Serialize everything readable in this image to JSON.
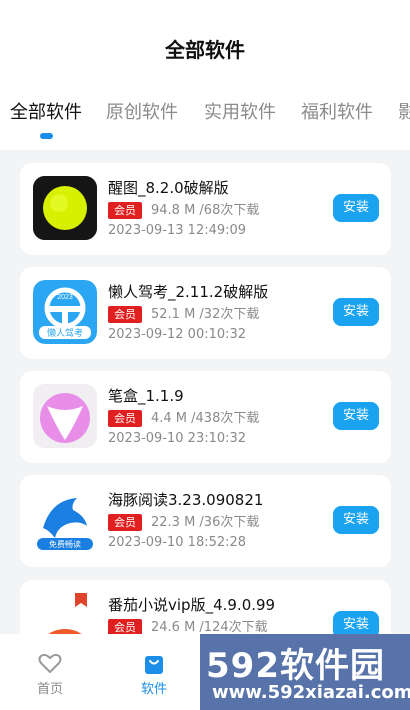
{
  "header": {
    "title": "全部软件"
  },
  "tabs": [
    {
      "label": "全部软件",
      "active": true
    },
    {
      "label": "原创软件"
    },
    {
      "label": "实用软件"
    },
    {
      "label": "福利软件"
    },
    {
      "label": "影"
    }
  ],
  "apps": [
    {
      "name": "醒图_8.2.0破解版",
      "badge": "会员",
      "meta": "94.8 M /68次下载",
      "date": "2023-09-13 12:49:09",
      "install": "安装",
      "icon": "xingtu-icon"
    },
    {
      "name": "懒人驾考_2.11.2破解版",
      "badge": "会员",
      "meta": "52.1 M /32次下载",
      "date": "2023-09-12 00:10:32",
      "install": "安装",
      "icon": "lanren-jiakao-icon"
    },
    {
      "name": "笔盒_1.1.9",
      "badge": "会员",
      "meta": "4.4 M /438次下载",
      "date": "2023-09-10 23:10:32",
      "install": "安装",
      "icon": "bihe-icon"
    },
    {
      "name": "海豚阅读3.23.090821",
      "badge": "会员",
      "meta": "22.3 M /36次下载",
      "date": "2023-09-10 18:52:28",
      "install": "安装",
      "icon": "haitun-icon"
    },
    {
      "name": "番茄小说vip版_4.9.0.99",
      "badge": "会员",
      "meta": "24.6 M /124次下载",
      "date": "",
      "install": "安装",
      "icon": "fanqie-icon"
    }
  ],
  "icon_texts": {
    "jiakao_number": "2023",
    "jiakao_label": "懒人驾考",
    "haitun_label": "免费畅读"
  },
  "bottom_nav": [
    {
      "label": "首页",
      "icon": "heart-icon",
      "active": false
    },
    {
      "label": "软件",
      "icon": "bag-icon",
      "active": true
    }
  ],
  "watermark": {
    "title": "592软件园",
    "url": "www.592xiazai.com"
  },
  "colors": {
    "accent": "#1a8ee8",
    "install": "#1aa3f0",
    "badge": "#e02020",
    "watermark": "#4664a0"
  }
}
